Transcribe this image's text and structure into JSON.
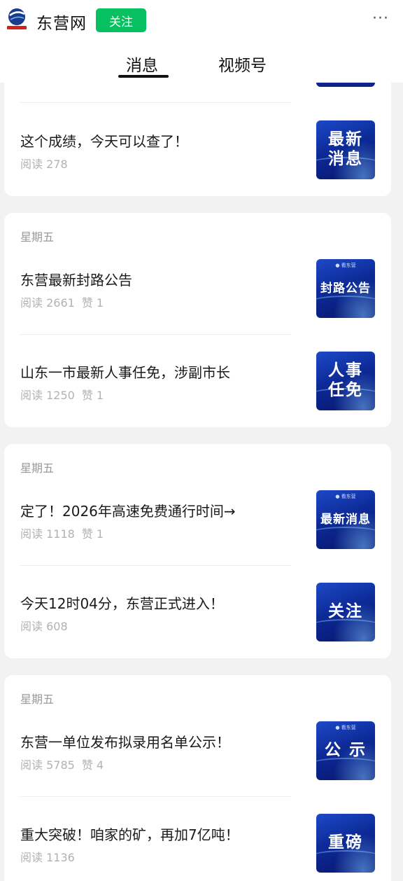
{
  "header": {
    "account_name": "东营网",
    "follow_label": "关注",
    "more_label": "···",
    "tabs": [
      {
        "label": "消息",
        "active": true
      },
      {
        "label": "视频号",
        "active": false
      }
    ]
  },
  "groups": [
    {
      "date": "",
      "articles": [
        {
          "title": "这个成绩，今天可以查了！",
          "reads": "阅读 278",
          "likes": "",
          "thumb": "最新\n消息",
          "thumb_badge": ""
        }
      ]
    },
    {
      "date": "星期五",
      "articles": [
        {
          "title": "东营最新封路公告",
          "reads": "阅读 2661",
          "likes": "赞 1",
          "thumb": "封路公告",
          "thumb_badge": "● 看东营"
        },
        {
          "title": "山东一市最新人事任免，涉副市长",
          "reads": "阅读 1250",
          "likes": "赞 1",
          "thumb": "人事\n任免",
          "thumb_badge": ""
        }
      ]
    },
    {
      "date": "星期五",
      "articles": [
        {
          "title": "定了！2026年高速免费通行时间→",
          "reads": "阅读 1118",
          "likes": "赞 1",
          "thumb": "最新消息",
          "thumb_badge": "● 看东营"
        },
        {
          "title": "今天12时04分，东营正式进入！",
          "reads": "阅读 608",
          "likes": "",
          "thumb": "关注",
          "thumb_badge": ""
        }
      ]
    },
    {
      "date": "星期五",
      "articles": [
        {
          "title": "东营一单位发布拟录用名单公示！",
          "reads": "阅读 5785",
          "likes": "赞 4",
          "thumb": "公 示",
          "thumb_badge": "● 看东营"
        },
        {
          "title": "重大突破！咱家的矿，再加7亿吨！",
          "reads": "阅读 1136",
          "likes": "",
          "thumb": "重磅",
          "thumb_badge": ""
        }
      ]
    }
  ],
  "colors": {
    "follow_green": "#07c160",
    "thumb_blue": "#0c2a96",
    "page_bg": "#f2f2f2"
  },
  "icons": {
    "logo": "dongying-net-logo",
    "more": "more-dots-icon"
  }
}
